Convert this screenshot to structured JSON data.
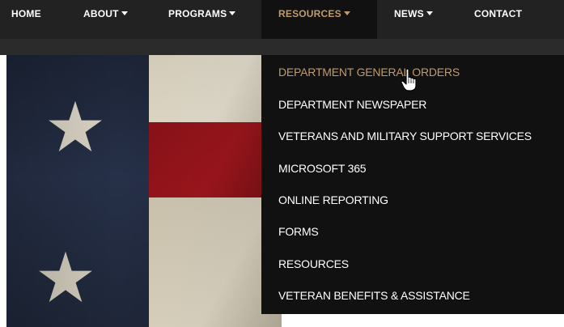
{
  "nav": {
    "items": [
      {
        "label": "HOME",
        "has_caret": false
      },
      {
        "label": "ABOUT",
        "has_caret": true
      },
      {
        "label": "PROGRAMS",
        "has_caret": true
      },
      {
        "label": "RESOURCES",
        "has_caret": true,
        "active": true
      },
      {
        "label": "NEWS",
        "has_caret": true
      },
      {
        "label": "CONTACT",
        "has_caret": false
      }
    ]
  },
  "dropdown": {
    "items": [
      {
        "label": "DEPARTMENT GENERAL ORDERS",
        "hovered": true
      },
      {
        "label": "DEPARTMENT NEWSPAPER"
      },
      {
        "label": "VETERANS AND MILITARY SUPPORT SERVICES"
      },
      {
        "label": "MICROSOFT 365"
      },
      {
        "label": "ONLINE REPORTING"
      },
      {
        "label": "FORMS"
      },
      {
        "label": "RESOURCES"
      },
      {
        "label": "VETERAN BENEFITS & ASSISTANCE"
      }
    ]
  },
  "colors": {
    "accent": "#c19a6b",
    "nav_bg": "#222222",
    "dropdown_bg": "#111111"
  },
  "icons": {
    "caret": "caret-down-icon",
    "cursor": "hand-pointer-icon"
  }
}
